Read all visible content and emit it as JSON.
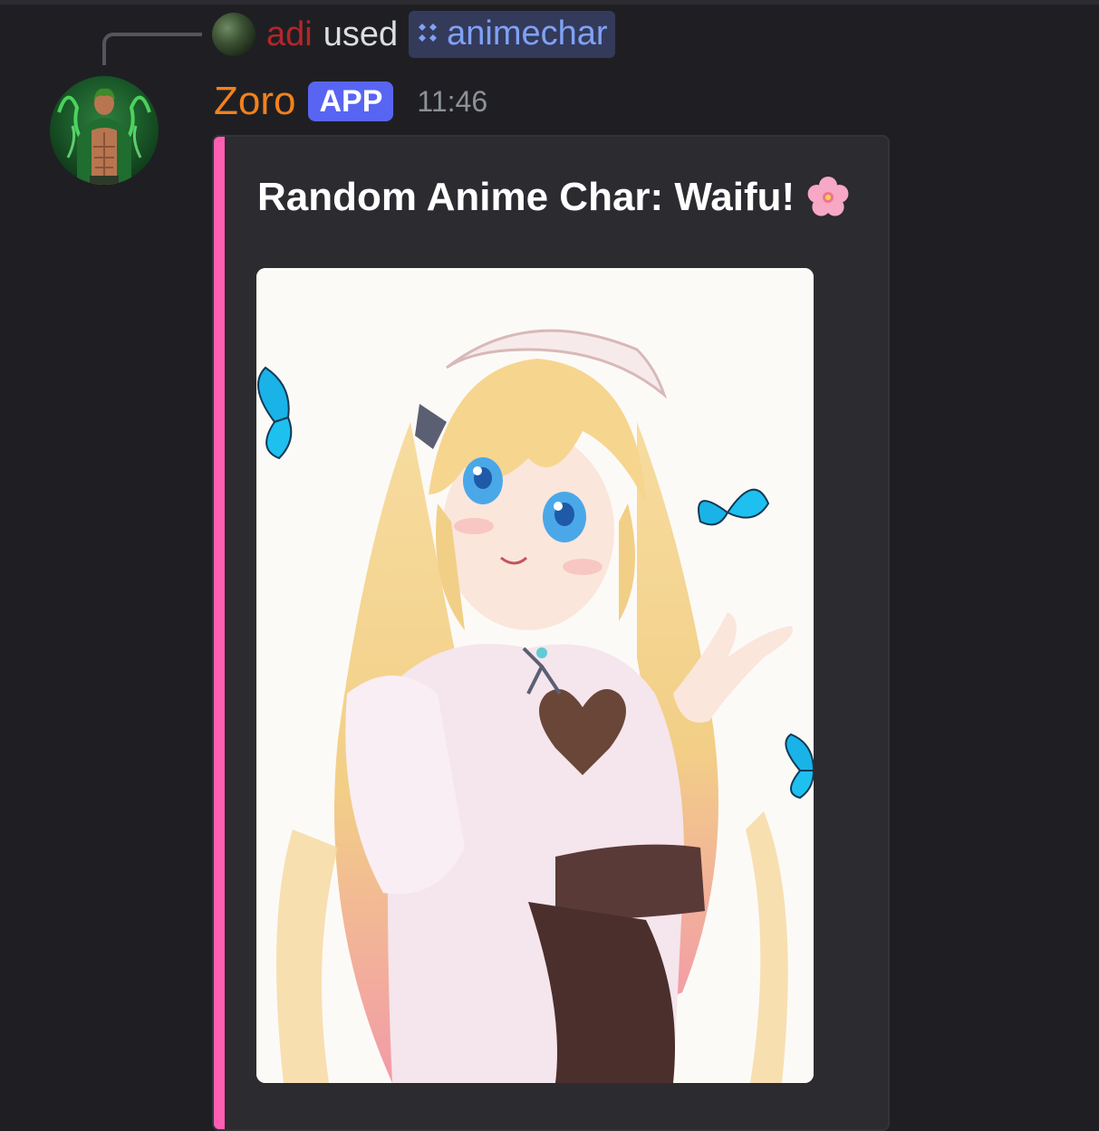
{
  "reply": {
    "user": "adi",
    "used_text": "used",
    "command": "animechar"
  },
  "message": {
    "username": "Zoro",
    "badge": "APP",
    "time": "11:46"
  },
  "embed": {
    "title": "Random Anime Char: Waifu!",
    "accent_color": "#ff5fb3",
    "title_icon": "cherry-blossom-icon",
    "image_description": "anime-waifu-image"
  },
  "colors": {
    "background": "#1f1f23",
    "username": "#f2811d",
    "badge": "#5865f2",
    "reply_user": "#b3262b",
    "command_chip": "#343a5a"
  }
}
